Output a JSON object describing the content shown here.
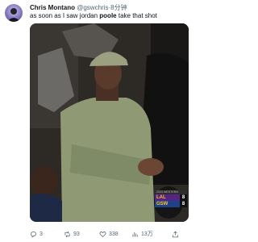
{
  "tweet": {
    "author_name": "Chris Montano",
    "author_handle": "@gswchris",
    "separator": "·",
    "time": "8分钟",
    "text_before": "as soon as I saw jordan ",
    "text_bold": "poole",
    "text_after": " take that shot"
  },
  "scoreboard": {
    "banner": "2023 WESTERN",
    "teams": [
      {
        "abbr": "LAL",
        "score": "8"
      },
      {
        "abbr": "GSW",
        "score": "8"
      }
    ]
  },
  "actions": {
    "replies": "3",
    "retweets": "93",
    "likes": "338",
    "views": "13万"
  },
  "icons": {
    "reply": "reply-icon",
    "retweet": "retweet-icon",
    "like": "heart-icon",
    "views": "views-icon",
    "share": "share-icon",
    "nba": "nba-logo-icon"
  },
  "colors": {
    "text": "#0f1419",
    "muted": "#536471",
    "lakers_purple": "#552583",
    "lakers_gold": "#fdb927",
    "warriors_blue": "#1d428a",
    "warriors_gold": "#ffc72c"
  }
}
